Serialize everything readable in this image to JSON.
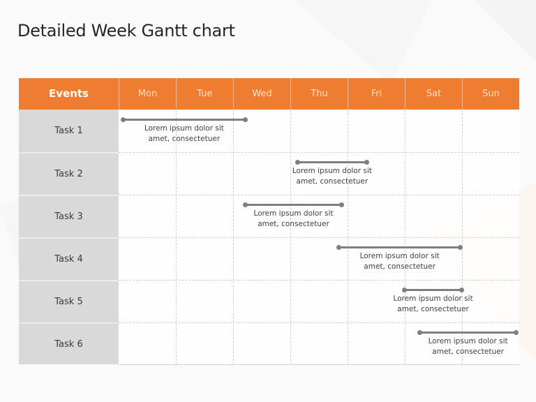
{
  "title": "Detailed Week Gantt chart",
  "colors": {
    "header": "#ee7d31",
    "task_column": "#d9d9d9",
    "bar": "#7f7f7f"
  },
  "chart_data": {
    "type": "gantt",
    "title": "Detailed Week Gantt chart",
    "header_label": "Events",
    "categories": [
      "Mon",
      "Tue",
      "Wed",
      "Thu",
      "Fri",
      "Sat",
      "Sun"
    ],
    "x_unit": "days from Monday start",
    "xlim": [
      0,
      7
    ],
    "grid": true,
    "tasks": [
      {
        "name": "Task 1",
        "start": 0.07,
        "end": 2.22,
        "label_line1": "Lorem ipsum dolor sit",
        "label_line2": "amet, consectetuer"
      },
      {
        "name": "Task 2",
        "start": 3.12,
        "end": 4.34,
        "label_line1": "Lorem ipsum dolor sit",
        "label_line2": "amet, consectetuer"
      },
      {
        "name": "Task 3",
        "start": 2.21,
        "end": 3.9,
        "label_line1": "Lorem ipsum dolor sit",
        "label_line2": "amet, consectetuer"
      },
      {
        "name": "Task 4",
        "start": 3.84,
        "end": 5.98,
        "label_line1": "Lorem ipsum dolor sit",
        "label_line2": "amet, consectetuer"
      },
      {
        "name": "Task 5",
        "start": 4.99,
        "end": 6.0,
        "label_line1": "Lorem ipsum dolor sit",
        "label_line2": "amet, consectetuer"
      },
      {
        "name": "Task 6",
        "start": 5.26,
        "end": 6.95,
        "label_line1": "Lorem ipsum dolor sit",
        "label_line2": "amet, consectetuer"
      }
    ]
  }
}
